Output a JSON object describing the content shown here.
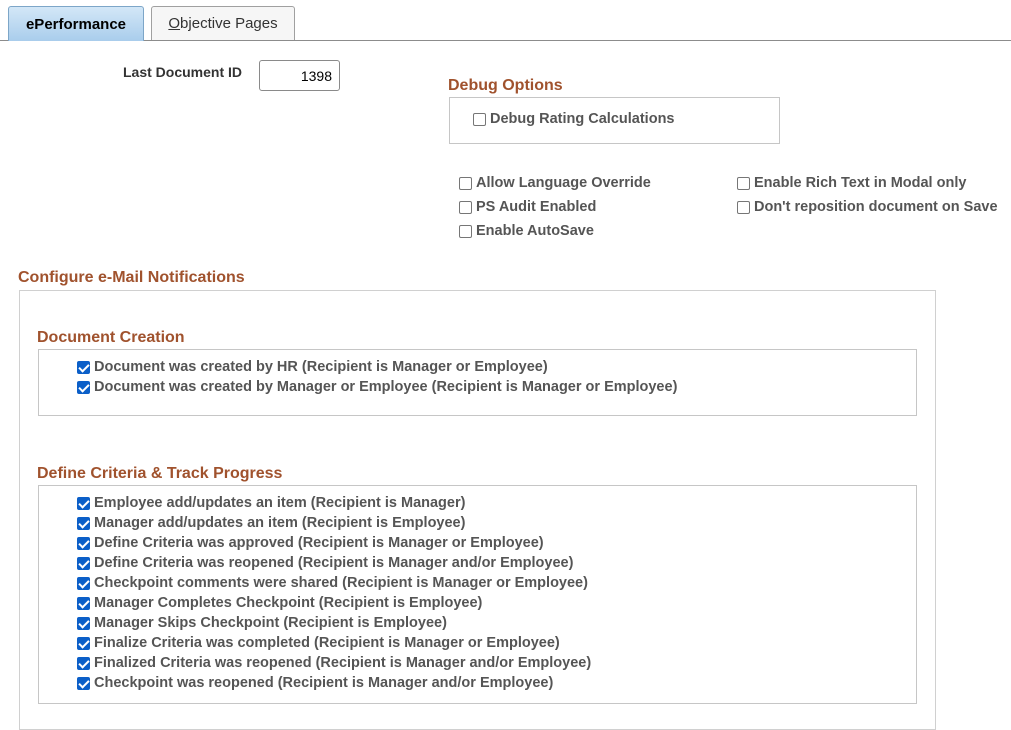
{
  "tabs": [
    {
      "label": "ePerformance",
      "active": true
    },
    {
      "label_first": "O",
      "label_rest": "bjective Pages",
      "active": false
    }
  ],
  "last_document": {
    "label": "Last Document ID",
    "value": "1398"
  },
  "debug": {
    "title": "Debug Options",
    "items": [
      {
        "label": "Debug Rating Calculations",
        "checked": false
      }
    ]
  },
  "options_left": [
    {
      "label": "Allow Language Override",
      "checked": false
    },
    {
      "label": "PS Audit Enabled",
      "checked": false
    },
    {
      "label": "Enable AutoSave",
      "checked": false
    }
  ],
  "options_right": [
    {
      "label": "Enable Rich Text in Modal only",
      "checked": false
    },
    {
      "label": "Don't reposition document on Save",
      "checked": false
    }
  ],
  "notifications": {
    "title": "Configure e-Mail Notifications",
    "document_creation": {
      "title": "Document Creation",
      "items": [
        {
          "label": "Document was created by HR (Recipient is Manager or Employee)",
          "checked": true
        },
        {
          "label": "Document was created by Manager or Employee (Recipient is Manager or Employee)",
          "checked": true
        }
      ]
    },
    "define_criteria": {
      "title": "Define Criteria & Track Progress",
      "items": [
        {
          "label": "Employee add/updates an item (Recipient is Manager)",
          "checked": true
        },
        {
          "label": "Manager add/updates an item (Recipient is Employee)",
          "checked": true
        },
        {
          "label": "Define Criteria was approved (Recipient is Manager or Employee)",
          "checked": true
        },
        {
          "label": "Define Criteria was reopened (Recipient is Manager and/or Employee)",
          "checked": true
        },
        {
          "label": "Checkpoint comments were shared (Recipient is Manager or Employee)",
          "checked": true
        },
        {
          "label": "Manager Completes Checkpoint (Recipient is Employee)",
          "checked": true
        },
        {
          "label": "Manager Skips Checkpoint (Recipient is Employee)",
          "checked": true
        },
        {
          "label": "Finalize Criteria was completed (Recipient is Manager or Employee)",
          "checked": true
        },
        {
          "label": "Finalized Criteria was reopened (Recipient is Manager and/or Employee)",
          "checked": true
        },
        {
          "label": "Checkpoint was reopened (Recipient is Manager and/or Employee)",
          "checked": true
        }
      ]
    }
  },
  "colors": {
    "section_title": "#a0522d",
    "checkbox_checked": "#0b5fc8",
    "tab_active": "#a9cdec"
  }
}
